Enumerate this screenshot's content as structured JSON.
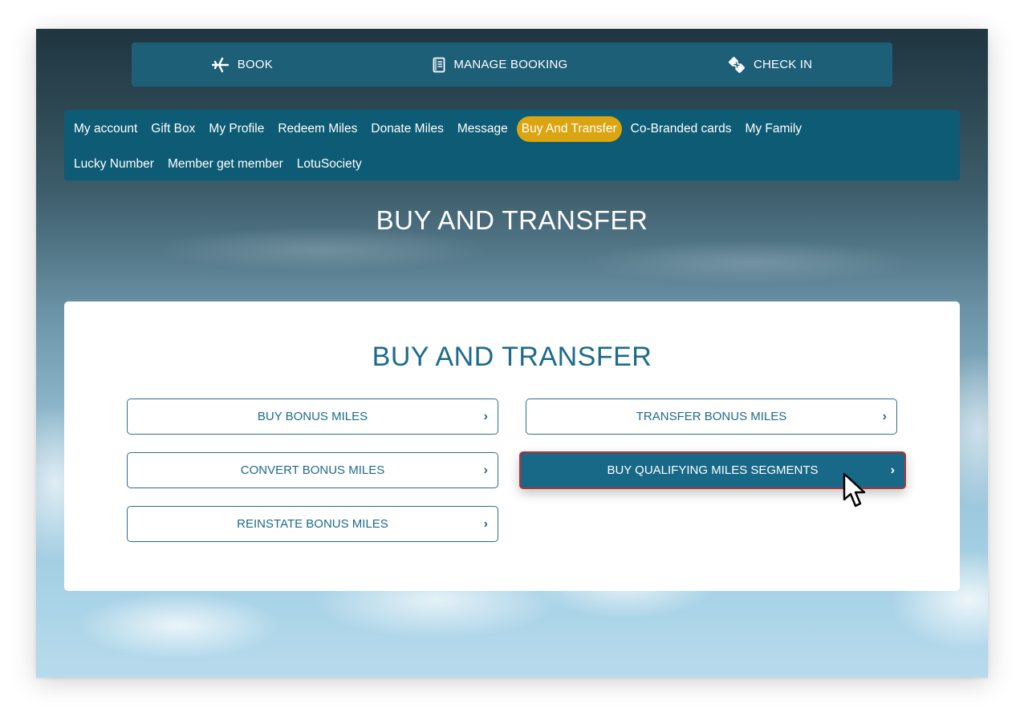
{
  "top_bar": {
    "items": [
      {
        "label": "BOOK",
        "icon": "airplane-icon"
      },
      {
        "label": "MANAGE BOOKING",
        "icon": "booking-document-icon"
      },
      {
        "label": "CHECK IN",
        "icon": "boarding-pass-icon"
      }
    ]
  },
  "account_nav": {
    "active": "Buy And Transfer",
    "active_color": "#dba511",
    "items": [
      {
        "label": "My account"
      },
      {
        "label": "Gift Box"
      },
      {
        "label": "My Profile"
      },
      {
        "label": "Redeem Miles"
      },
      {
        "label": "Donate Miles"
      },
      {
        "label": "Message"
      },
      {
        "label": "Buy And Transfer"
      },
      {
        "label": "Co-Branded cards"
      },
      {
        "label": "My Family"
      },
      {
        "label": "Lucky Number"
      },
      {
        "label": "Member get member"
      },
      {
        "label": "LotuSociety"
      }
    ]
  },
  "page": {
    "heading": "BUY AND TRANSFER"
  },
  "card": {
    "title": "BUY AND TRANSFER",
    "chevron": "›",
    "options": [
      {
        "label": "BUY BONUS MILES"
      },
      {
        "label": "TRANSFER BONUS MILES"
      },
      {
        "label": "CONVERT BONUS MILES"
      },
      {
        "label": "BUY QUALIFYING MILES SEGMENTS",
        "state": "hovered"
      },
      {
        "label": "REINSTATE BONUS MILES"
      }
    ]
  },
  "colors": {
    "brand_teal": "#0d5b74",
    "top_bar": "#1e5f78",
    "accent_gold": "#dba511",
    "hover_border": "#b73032",
    "text_teal": "#1d6a8a"
  }
}
